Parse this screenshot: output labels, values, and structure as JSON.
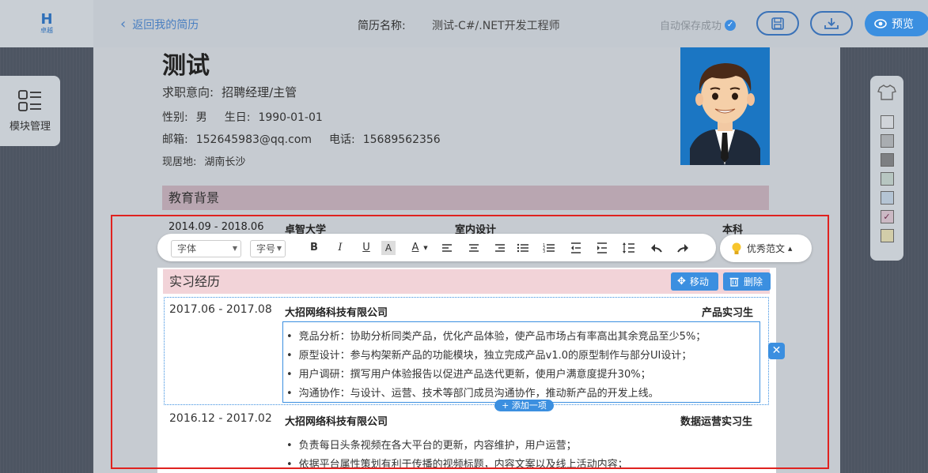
{
  "header": {
    "logo_text": "卓越",
    "back_label": "返回我的简历",
    "resume_name_label": "简历名称:",
    "resume_name": "测试-C#/.NET开发工程师",
    "autosave_text": "自动保存成功",
    "preview_label": "预览"
  },
  "sidebar_left": {
    "module_manage_label": "模块管理"
  },
  "profile": {
    "name": "测试",
    "intention_label": "求职意向:",
    "intention": "招聘经理/主管",
    "gender_label": "性别:",
    "gender": "男",
    "birthday_label": "生日:",
    "birthday": "1990-01-01",
    "email_label": "邮箱:",
    "email": "152645983@qq.com",
    "phone_label": "电话:",
    "phone": "15689562356",
    "location_label": "现居地:",
    "location": "湖南长沙"
  },
  "education": {
    "title": "教育背景",
    "date": "2014.09 - 2018.06",
    "school": "卓智大学",
    "major": "室内设计",
    "degree": "本科"
  },
  "toolbar": {
    "font_label": "字体",
    "size_label": "字号",
    "example_label": "优秀范文"
  },
  "internship": {
    "title": "实习经历",
    "move_label": "移动",
    "delete_label": "删除",
    "add_item_label": "添加一项",
    "entries": [
      {
        "date": "2017.06 - 2017.08",
        "company": "大招网络科技有限公司",
        "role": "产品实习生",
        "bullets": [
          "竞品分析：协助分析同类产品，优化产品体验，使产品市场占有率高出其余竞品至少5%；",
          "原型设计：参与构架新产品的功能模块，独立完成产品v1.0的原型制作与部分UI设计；",
          "用户调研：撰写用户体验报告以促进产品迭代更新，使用户满意度提升30%；",
          "沟通协作：与设计、运营、技术等部门成员沟通协作，推动新产品的开发上线。"
        ]
      },
      {
        "date": "2016.12 - 2017.02",
        "company": "大招网络科技有限公司",
        "role": "数据运营实习生",
        "bullets": [
          "负责每日头条视频在各大平台的更新，内容维护，用户运营；",
          "依据平台属性策划有利于传播的视频标题，内容文案以及线上活动内容；"
        ]
      }
    ]
  },
  "colors": {
    "accent": "#3b8fe0",
    "edu_header": "#b9a6b1",
    "intern_header": "#f2d3d8",
    "highlight_frame": "#e0221f"
  }
}
